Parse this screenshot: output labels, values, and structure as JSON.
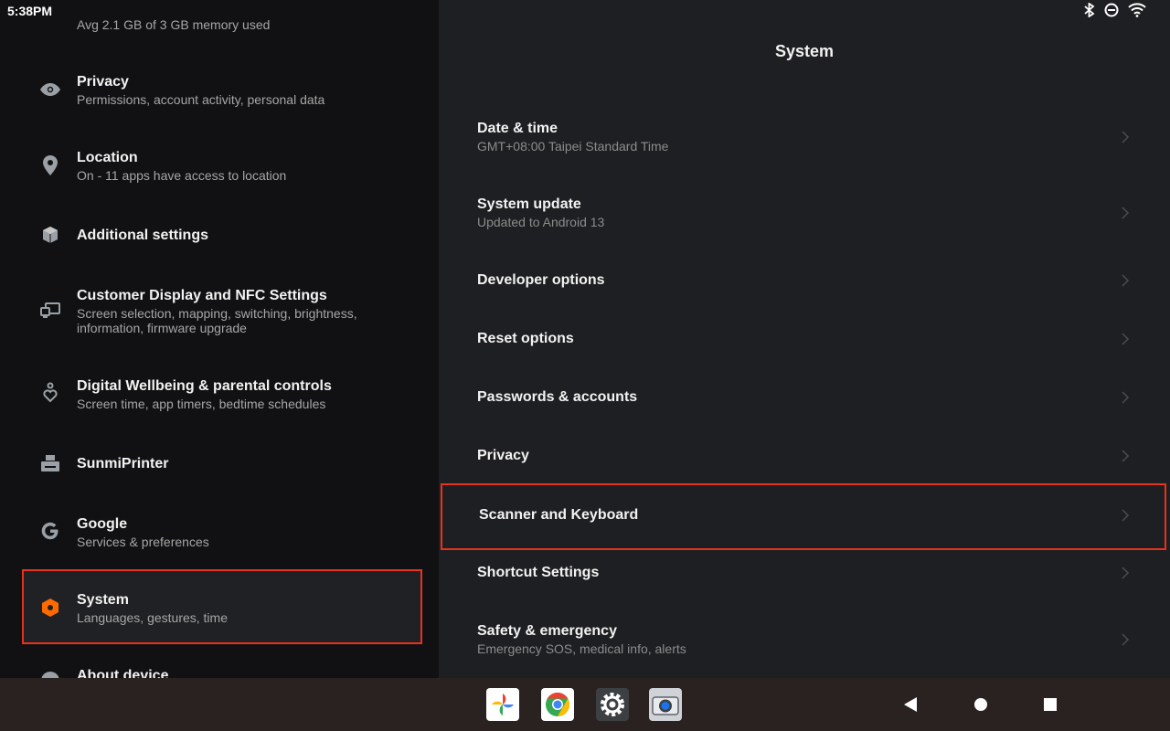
{
  "status": {
    "time": "5:38PM"
  },
  "left": {
    "items": [
      {
        "title": "",
        "subtitle": "Avg 2.1 GB of 3 GB memory used"
      },
      {
        "title": "Privacy",
        "subtitle": "Permissions, account activity, personal data"
      },
      {
        "title": "Location",
        "subtitle": "On - 11 apps have access to location"
      },
      {
        "title": "Additional settings",
        "subtitle": ""
      },
      {
        "title": "Customer Display and NFC Settings",
        "subtitle": "Screen selection, mapping, switching, brightness, information, firmware upgrade"
      },
      {
        "title": "Digital Wellbeing & parental controls",
        "subtitle": "Screen time, app timers, bedtime schedules"
      },
      {
        "title": "SunmiPrinter",
        "subtitle": ""
      },
      {
        "title": "Google",
        "subtitle": "Services & preferences"
      },
      {
        "title": "System",
        "subtitle": "Languages, gestures, time"
      },
      {
        "title": "About device",
        "subtitle": ""
      }
    ],
    "accent_color": "#ff6a00"
  },
  "right": {
    "header": "System",
    "items": [
      {
        "title": "Date & time",
        "subtitle": "GMT+08:00 Taipei Standard Time"
      },
      {
        "title": "System update",
        "subtitle": "Updated to Android 13"
      },
      {
        "title": "Developer options",
        "subtitle": ""
      },
      {
        "title": "Reset options",
        "subtitle": ""
      },
      {
        "title": "Passwords & accounts",
        "subtitle": ""
      },
      {
        "title": "Privacy",
        "subtitle": ""
      },
      {
        "title": "Scanner and Keyboard",
        "subtitle": ""
      },
      {
        "title": "Shortcut Settings",
        "subtitle": ""
      },
      {
        "title": "Safety & emergency",
        "subtitle": "Emergency SOS, medical info, alerts"
      }
    ]
  },
  "dock": {
    "apps": [
      "photos-app-icon",
      "chrome-app-icon",
      "settings-app-icon",
      "camera-app-icon"
    ]
  },
  "highlight_color": "#e8321c"
}
